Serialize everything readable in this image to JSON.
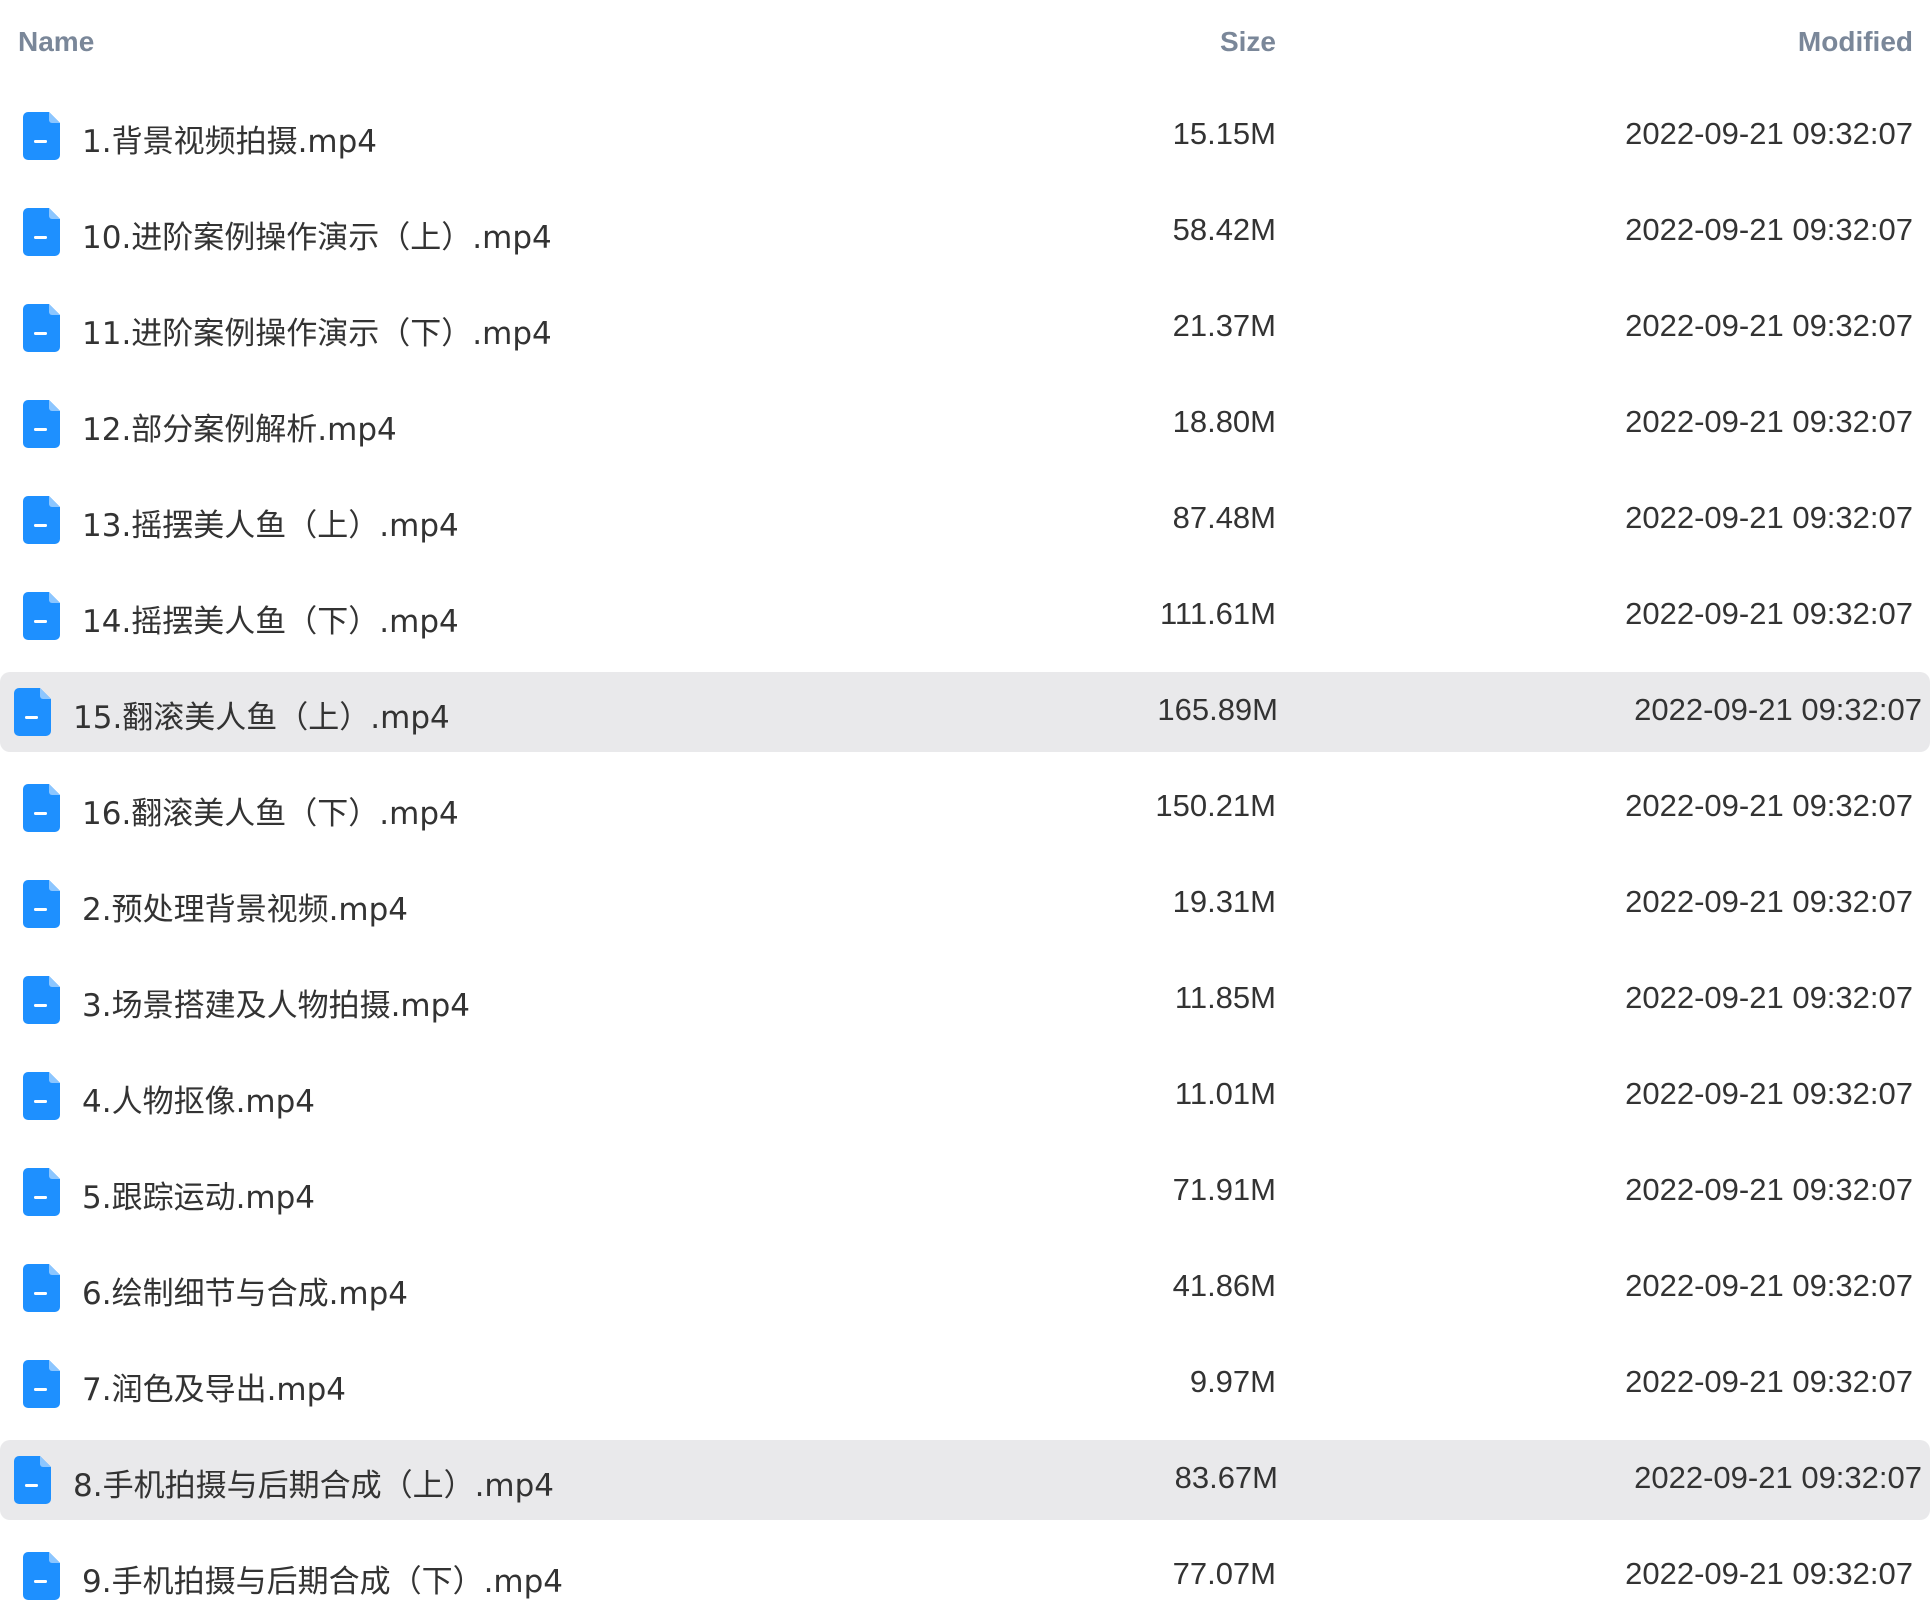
{
  "table": {
    "columns": {
      "name": "Name",
      "size": "Size",
      "modified": "Modified"
    },
    "icon": "document-icon",
    "icon_color": "#1e90ff",
    "highlight_color": "#e9e9eb",
    "rows": [
      {
        "name": "1.背景视频拍摄.mp4",
        "size": "15.15M",
        "modified": "2022-09-21 09:32:07",
        "selected": false
      },
      {
        "name": "10.进阶案例操作演示（上）.mp4",
        "size": "58.42M",
        "modified": "2022-09-21 09:32:07",
        "selected": false
      },
      {
        "name": "11.进阶案例操作演示（下）.mp4",
        "size": "21.37M",
        "modified": "2022-09-21 09:32:07",
        "selected": false
      },
      {
        "name": "12.部分案例解析.mp4",
        "size": "18.80M",
        "modified": "2022-09-21 09:32:07",
        "selected": false
      },
      {
        "name": "13.摇摆美人鱼（上）.mp4",
        "size": "87.48M",
        "modified": "2022-09-21 09:32:07",
        "selected": false
      },
      {
        "name": "14.摇摆美人鱼（下）.mp4",
        "size": "111.61M",
        "modified": "2022-09-21 09:32:07",
        "selected": false
      },
      {
        "name": "15.翻滚美人鱼（上）.mp4",
        "size": "165.89M",
        "modified": "2022-09-21 09:32:07",
        "selected": true
      },
      {
        "name": "16.翻滚美人鱼（下）.mp4",
        "size": "150.21M",
        "modified": "2022-09-21 09:32:07",
        "selected": false
      },
      {
        "name": "2.预处理背景视频.mp4",
        "size": "19.31M",
        "modified": "2022-09-21 09:32:07",
        "selected": false
      },
      {
        "name": "3.场景搭建及人物拍摄.mp4",
        "size": "11.85M",
        "modified": "2022-09-21 09:32:07",
        "selected": false
      },
      {
        "name": "4.人物抠像.mp4",
        "size": "11.01M",
        "modified": "2022-09-21 09:32:07",
        "selected": false
      },
      {
        "name": "5.跟踪运动.mp4",
        "size": "71.91M",
        "modified": "2022-09-21 09:32:07",
        "selected": false
      },
      {
        "name": "6.绘制细节与合成.mp4",
        "size": "41.86M",
        "modified": "2022-09-21 09:32:07",
        "selected": false
      },
      {
        "name": "7.润色及导出.mp4",
        "size": "9.97M",
        "modified": "2022-09-21 09:32:07",
        "selected": false
      },
      {
        "name": "8.手机拍摄与后期合成（上）.mp4",
        "size": "83.67M",
        "modified": "2022-09-21 09:32:07",
        "selected": true
      },
      {
        "name": "9.手机拍摄与后期合成（下）.mp4",
        "size": "77.07M",
        "modified": "2022-09-21 09:32:07",
        "selected": false
      }
    ]
  }
}
